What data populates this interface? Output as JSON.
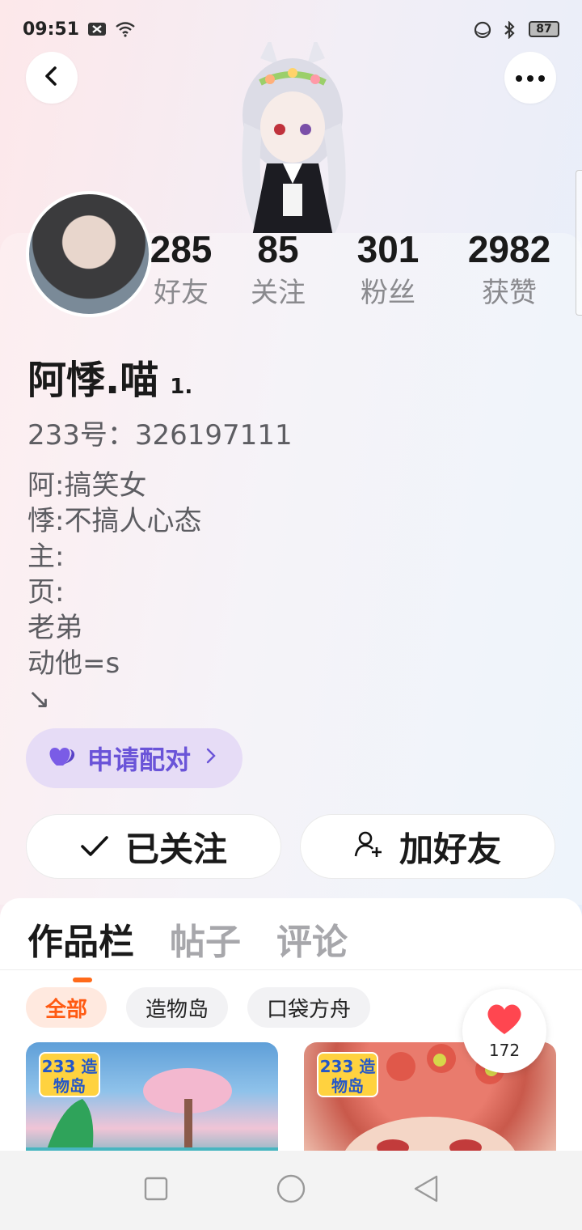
{
  "status_bar": {
    "time": "09:51",
    "battery": "87"
  },
  "header": {
    "back_icon": "chevron-left-icon",
    "more_icon": "more-dots-icon"
  },
  "stats": [
    {
      "value": "285",
      "label": "好友"
    },
    {
      "value": "85",
      "label": "关注"
    },
    {
      "value": "301",
      "label": "粉丝"
    },
    {
      "value": "2982",
      "label": "获赞"
    }
  ],
  "profile": {
    "name": "阿悸.喵",
    "badge": "1.",
    "uid": "233号：326197111",
    "bio": [
      "阿:搞笑女",
      "悸:不搞人心态",
      "主:",
      "页:",
      "老弟",
      "动他=s",
      "↘"
    ]
  },
  "pair_button": {
    "label": "申请配对"
  },
  "actions": {
    "followed": "已关注",
    "add_friend": "加好友"
  },
  "tabs": [
    {
      "label": "作品栏",
      "active": true
    },
    {
      "label": "帖子",
      "active": false
    },
    {
      "label": "评论",
      "active": false
    }
  ],
  "chips": [
    {
      "label": "全部",
      "active": true
    },
    {
      "label": "造物岛",
      "active": false
    },
    {
      "label": "口袋方舟",
      "active": false
    }
  ],
  "thumbnails": [
    {
      "logo_text": "233 造物岛"
    },
    {
      "logo_text": "233 造物岛"
    }
  ],
  "like_float": {
    "count": "172"
  },
  "colors": {
    "accent_orange": "#ff6a1a",
    "pair_purple": "#6a54d8",
    "heart_red": "#ff4650"
  }
}
